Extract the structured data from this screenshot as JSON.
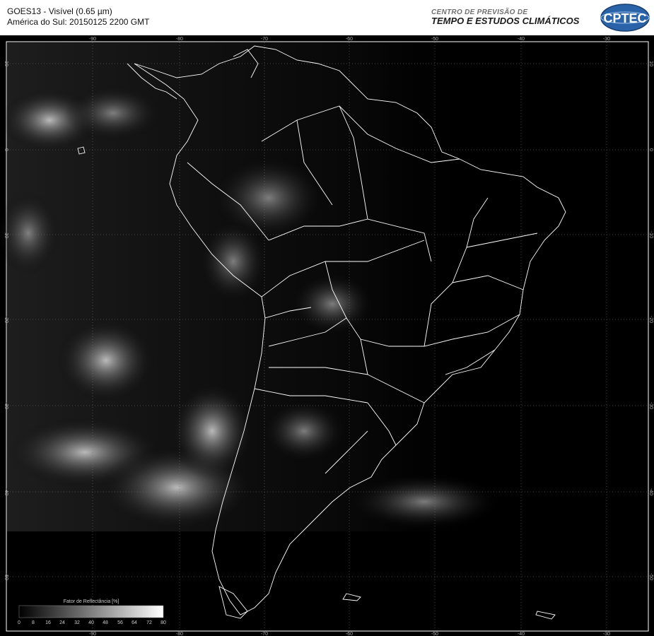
{
  "header": {
    "title_line1": "GOES13 - Visível (0.65 µm)",
    "title_line2": "América do Sul: 20150125 2200 GMT",
    "org_line1": "CENTRO DE PREVISÃO DE",
    "org_line2": "TEMPO E ESTUDOS CLIMÁTICOS",
    "logo_text": "CPTEC"
  },
  "map": {
    "longitude_labels": [
      "-90",
      "-80",
      "-70",
      "-60",
      "-50",
      "-40",
      "-30"
    ],
    "latitude_labels": [
      "10",
      "0",
      "-10",
      "-20",
      "-30",
      "-40",
      "-50"
    ],
    "background_color": "#000000",
    "border_line_color": "#ffffff"
  },
  "legend": {
    "title": "Fator de Reflectância [%]",
    "ticks": [
      "0",
      "8",
      "16",
      "24",
      "32",
      "40",
      "48",
      "56",
      "64",
      "72",
      "80"
    ]
  }
}
